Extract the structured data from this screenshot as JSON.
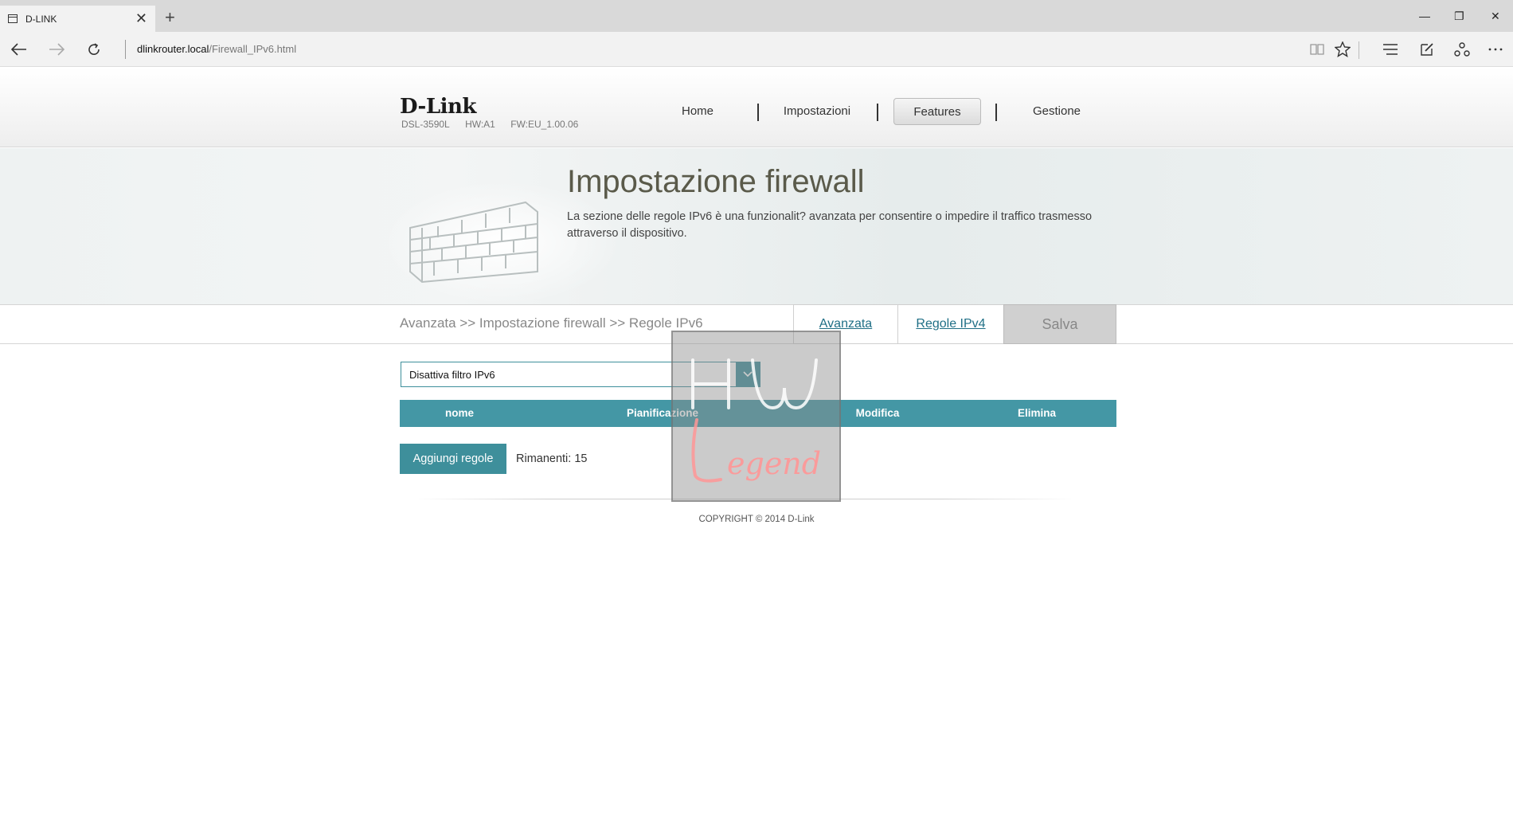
{
  "browser": {
    "tab_title": "D-LINK",
    "tab_close": "✕",
    "new_tab": "+",
    "url_host": "dlinkrouter.local",
    "url_path": "/Firewall_IPv6.html",
    "win_minimize": "—",
    "win_restore": "❐",
    "win_close": "✕"
  },
  "header": {
    "logo": "D-Link",
    "model": "DSL-3590L",
    "hw": "HW:A1",
    "fw": "FW:EU_1.00.06",
    "menu": {
      "home": "Home",
      "settings": "Impostazioni",
      "features": "Features",
      "management": "Gestione"
    },
    "active_menu": "Features"
  },
  "banner": {
    "title": "Impostazione firewall",
    "description": "La sezione delle regole IPv6 è una funzionalit? avanzata per consentire o impedire il traffico trasmesso attraverso il dispositivo."
  },
  "breadcrumb": {
    "path": "Avanzata >> Impostazione firewall >> Regole IPv6",
    "tab_advanced": "Avanzata",
    "tab_ipv4": "Regole IPv4",
    "save": "Salva"
  },
  "filter": {
    "selected": "Disattiva filtro IPv6"
  },
  "table": {
    "headers": [
      "nome",
      "Pianificazione",
      "Modifica",
      "Elimina"
    ]
  },
  "actions": {
    "add_rules": "Aggiungi regole",
    "remaining": "Rimanenti: 15"
  },
  "footer": {
    "copyright": "COPYRIGHT © 2014 D-Link"
  },
  "colors": {
    "accent": "#4497a5",
    "button": "#3e8f9b",
    "title": "#5a5a4a"
  },
  "watermark": {
    "text": "Legend"
  }
}
